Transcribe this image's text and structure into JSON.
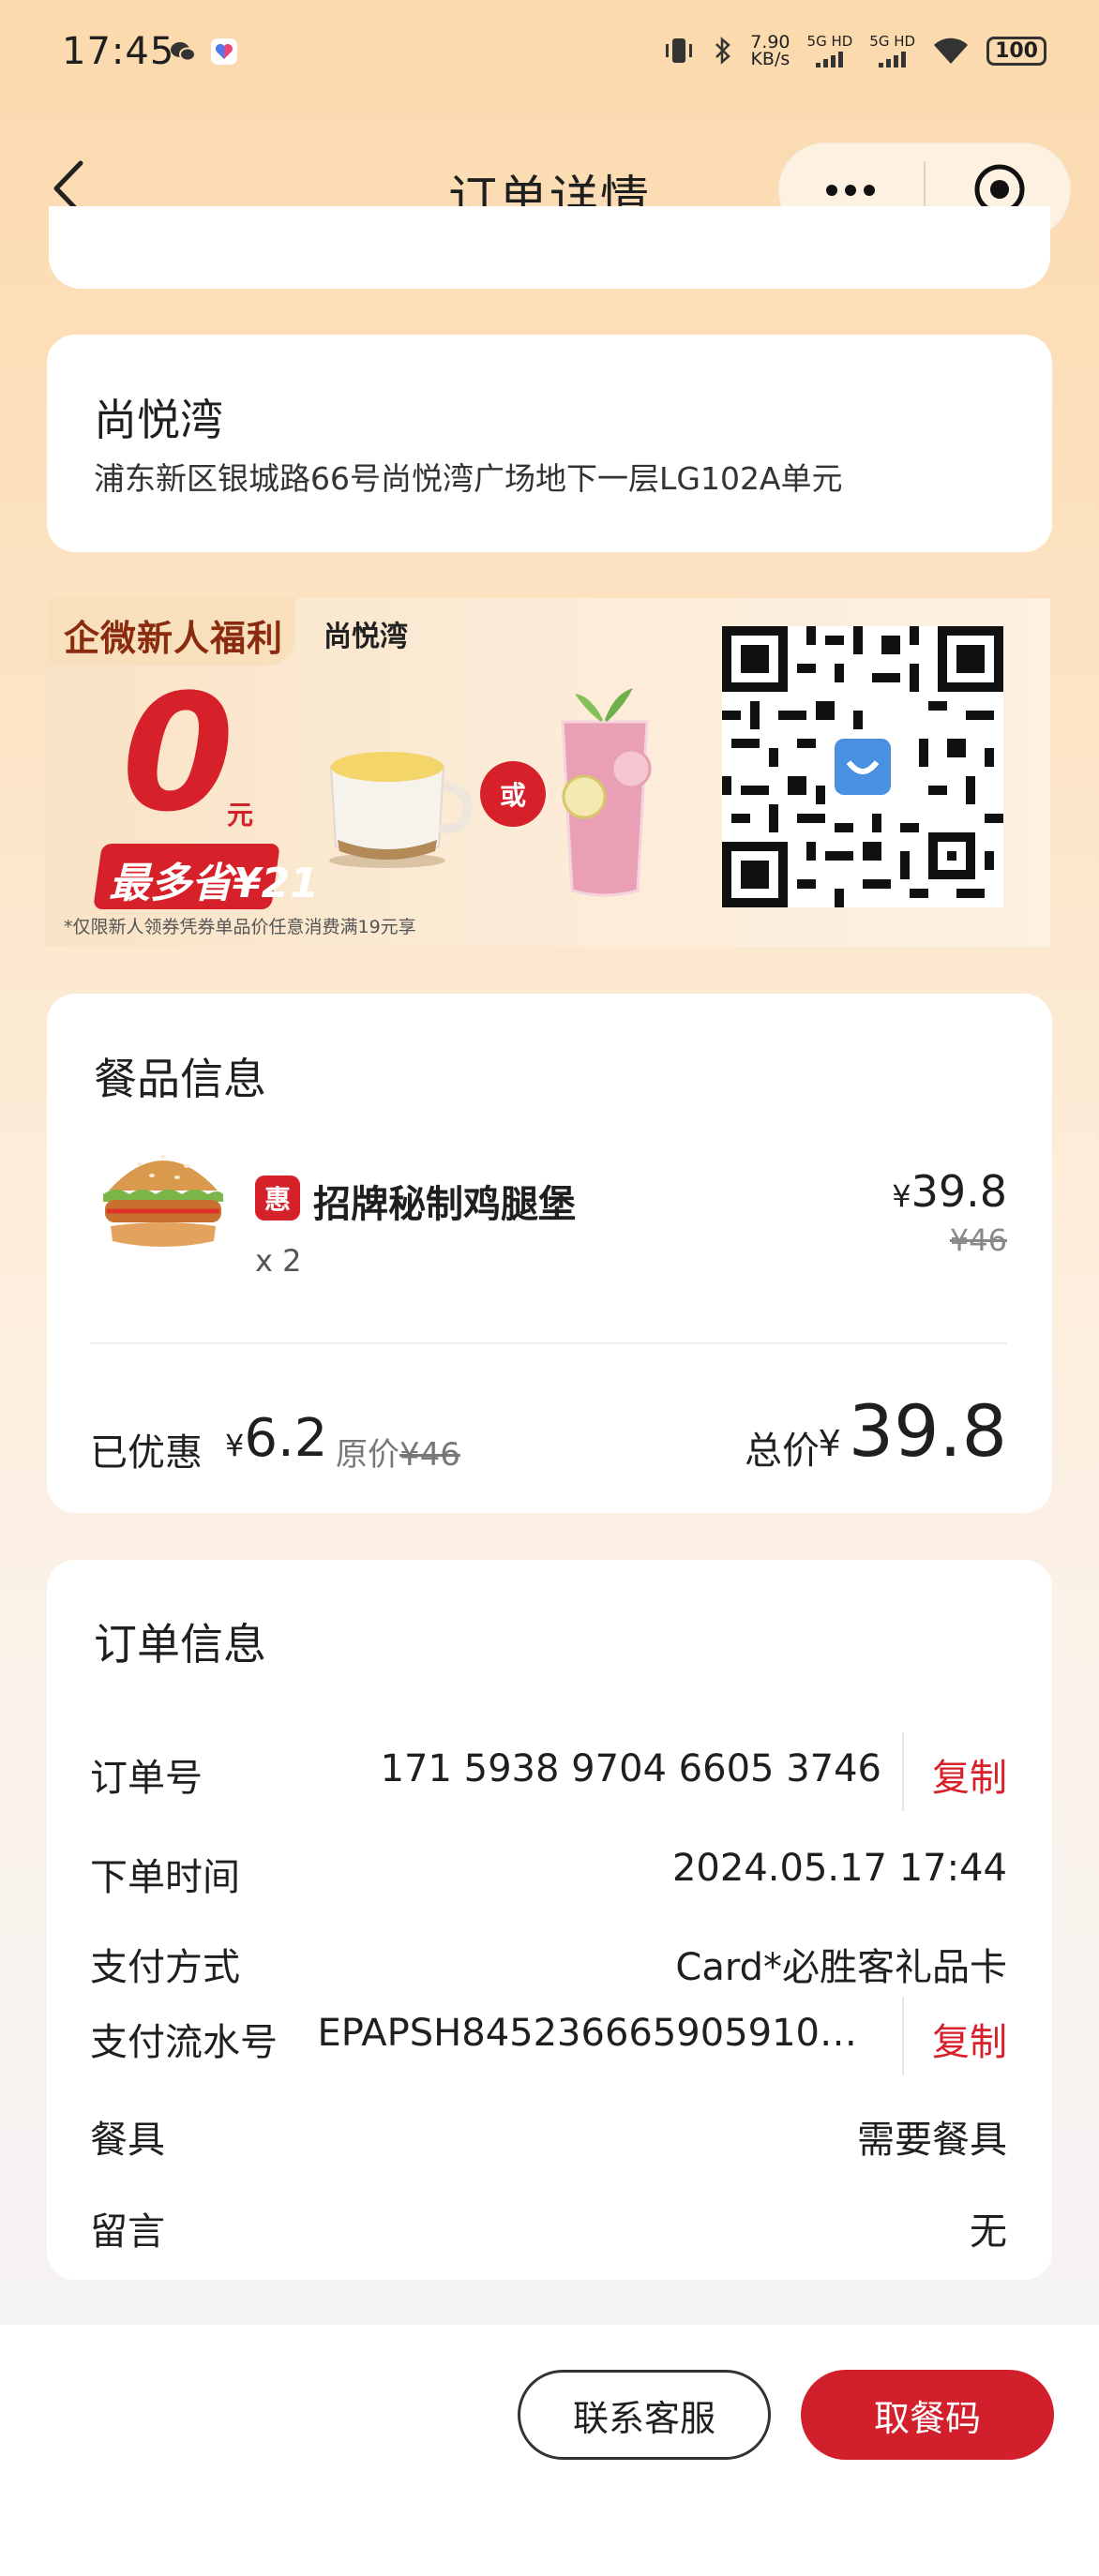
{
  "status_bar": {
    "time": "17:45",
    "net_speed_value": "7.90",
    "net_speed_unit": "KB/s",
    "sim1": "5G HD",
    "sim2": "5G HD",
    "battery": "100",
    "icons": [
      "wechat-icon",
      "app-heart-icon",
      "vibrate-icon",
      "bluetooth-icon",
      "wifi-icon"
    ]
  },
  "nav": {
    "title": "订单详情",
    "icons": [
      "back-icon",
      "more-icon",
      "target-icon"
    ]
  },
  "store": {
    "name": "尚悦湾",
    "address": "浦东新区银城路66号尚悦湾广场地下一层LG102A单元"
  },
  "banner": {
    "tag": "企微新人福利",
    "store": "尚悦湾",
    "big_number": "0",
    "unit": "元",
    "save_text": "最多省¥21",
    "or_text": "或",
    "note": "*仅限新人领券凭券单品价任意消费满19元享"
  },
  "food": {
    "section_title": "餐品信息",
    "item": {
      "badge": "惠",
      "name": "招牌秘制鸡腿堡",
      "qty": "x 2",
      "currency": "¥",
      "price": "39.8",
      "original_price": "¥46"
    },
    "discount_label": "已优惠",
    "discount_currency": "¥",
    "discount_value": "6.2",
    "original_label": "原价",
    "original_value": "¥46",
    "total_label": "总价",
    "total_currency": "¥",
    "total_value": "39.8"
  },
  "order": {
    "section_title": "订单信息",
    "copy_label": "复制",
    "rows": [
      {
        "label": "订单号",
        "value": "171 5938 9704 6605 3746"
      },
      {
        "label": "下单时间",
        "value": "2024.05.17 17:44"
      },
      {
        "label": "支付方式",
        "value": "Card*必胜客礼品卡"
      },
      {
        "label": "支付流水号",
        "value": "EPAPSH845236665905910…"
      },
      {
        "label": "餐具",
        "value": "需要餐具"
      },
      {
        "label": "留言",
        "value": "无"
      }
    ]
  },
  "bottom": {
    "service_button": "联系客服",
    "pickup_button": "取餐码"
  },
  "colors": {
    "accent_red": "#d21f2c",
    "bg_top": "#fbd9ad"
  }
}
